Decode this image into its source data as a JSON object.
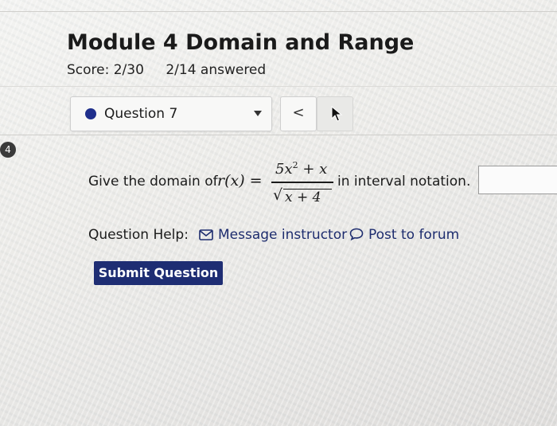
{
  "header": {
    "title": "Module 4 Domain and Range",
    "score": "Score: 2/30",
    "answered": "2/14 answered"
  },
  "question_nav": {
    "selected": "Question 7",
    "prev_label": "<",
    "status_color": "#1f2f8c",
    "badge": "4"
  },
  "question": {
    "prompt_before": "Give the domain of",
    "function_lhs": "r(x) =",
    "numerator": "5x",
    "numerator_exp": "2",
    "numerator_rest": " + x",
    "denominator": "x + 4",
    "prompt_after": "in interval notation.",
    "answer_value": ""
  },
  "help": {
    "label": "Question Help:",
    "message_instructor": "Message instructor",
    "post_to_forum": "Post to forum"
  },
  "actions": {
    "submit_label": "Submit Question",
    "submit_color": "#1e2d73"
  },
  "icons": [
    "envelope-icon",
    "speech-bubble-icon",
    "mouse-cursor-icon",
    "chevron-left-icon",
    "caret-down-icon"
  ]
}
